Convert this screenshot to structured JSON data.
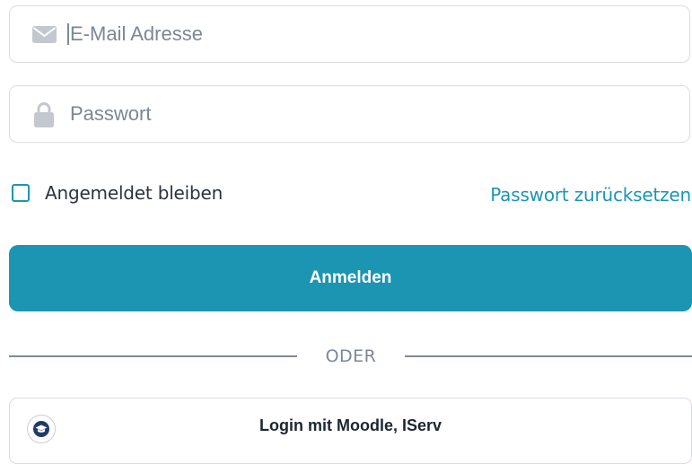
{
  "login_form": {
    "email_field": {
      "placeholder": "E-Mail Adresse",
      "value": "",
      "icon": "envelope-icon"
    },
    "password_field": {
      "placeholder": "Passwort",
      "value": "",
      "icon": "lock-icon"
    },
    "remember_me": {
      "label": "Angemeldet bleiben",
      "checked": false
    },
    "reset_password_link": "Passwort zurücksetzen",
    "submit_label": "Anmelden",
    "divider_text": "ODER",
    "sso_button": {
      "label": "Login mit Moodle, IServ",
      "icon": "graduation-cap-icon"
    }
  },
  "colors": {
    "accent": "#1b95b2",
    "border": "#d9dde3",
    "text": "#2a3440",
    "placeholder": "#7b8794",
    "icon_gray": "#c3c8cf",
    "sso_icon": "#1f3c68"
  }
}
